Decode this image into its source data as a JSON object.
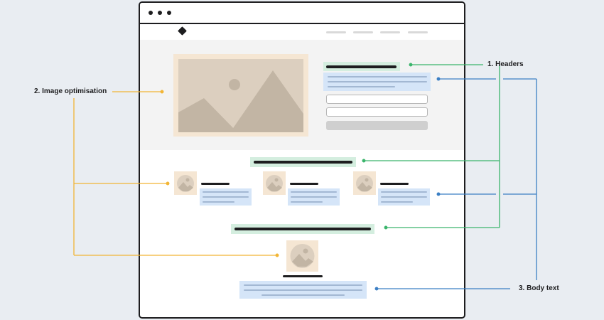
{
  "annotations": {
    "headers": "1. Headers",
    "image_optimisation": "2. Image optimisation",
    "body_text": "3. Body text"
  },
  "colors": {
    "headers": "#3bb56c",
    "image_optimisation": "#f2b535",
    "body_text": "#3b7fc4",
    "image_frame": "#f5e6d3",
    "image_fill": "#dccfbf",
    "image_shape": "#c2b5a4"
  },
  "icons": {
    "logo": "diamond-icon",
    "image": "image-placeholder-icon",
    "window_controls": "dots-icon"
  }
}
